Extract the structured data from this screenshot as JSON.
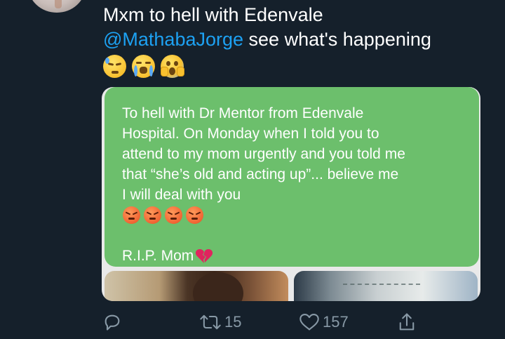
{
  "tweet": {
    "line1": "Mxm to hell with Edenvale",
    "mention": "@MathabaJorge",
    "line2_rest": " see what's happening",
    "emojis": [
      "downcast-sweat-face",
      "loudly-crying-face",
      "screaming-face"
    ]
  },
  "media": {
    "message_lines": [
      "To hell with Dr Mentor from Edenvale",
      "Hospital. On Monday when I told you to",
      "attend to my mom urgently and you told me",
      "that “she’s old and acting up”... believe me",
      "I will deal with you"
    ],
    "angry_emoji_count": 4,
    "closing": "R.I.P. Mom",
    "bubble_color": "#6cbf6c"
  },
  "actions": {
    "retweets": "15",
    "likes": "157",
    "icon_color": "#8899a6"
  },
  "theme": {
    "background": "#15202b",
    "mention_color": "#1da1f2"
  }
}
